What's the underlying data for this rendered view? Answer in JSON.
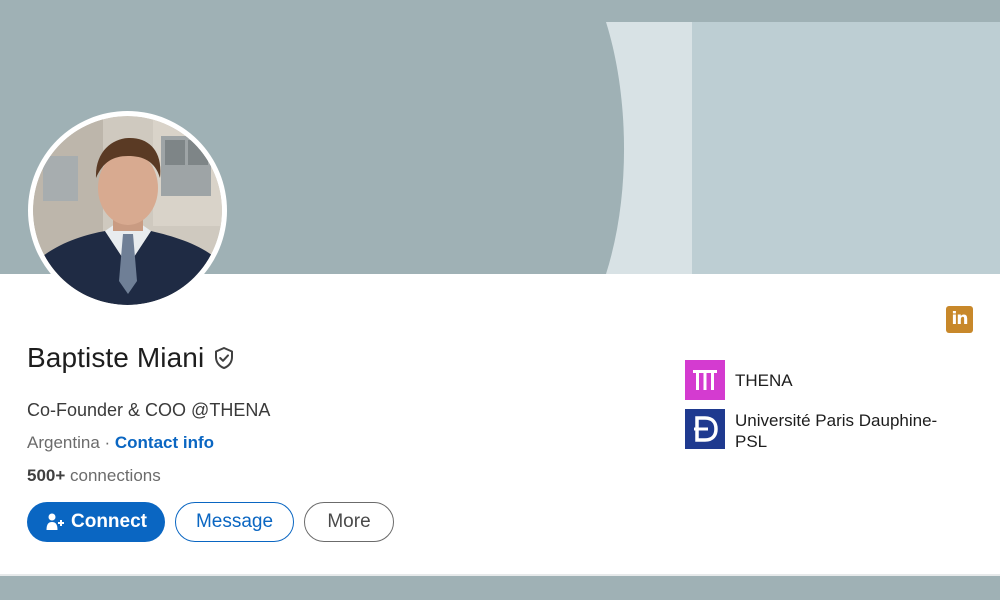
{
  "colors": {
    "banner_base": "#9fb1b5",
    "banner_light": "#d8e2e5",
    "banner_right": "#bdced3",
    "primary": "#0a66c2",
    "thena_logo": "#d43bd0",
    "dauphine_logo": "#1f3a8f",
    "linkedin_badge": "#c8882a"
  },
  "profile": {
    "name": "Baptiste Miani",
    "headline": "Co-Founder & COO @THENA",
    "location": "Argentina",
    "separator": " · ",
    "contact_link": "Contact info",
    "connections_count": "500+",
    "connections_label": " connections"
  },
  "actions": {
    "connect_label": "Connect",
    "message_label": "Message",
    "more_label": "More"
  },
  "badge": {
    "text": "in",
    "icon": "linkedin-icon"
  },
  "organizations": [
    {
      "name": "THENA",
      "icon": "thena-logo"
    },
    {
      "name": "Université Paris Dauphine-PSL",
      "icon": "dauphine-logo"
    }
  ]
}
